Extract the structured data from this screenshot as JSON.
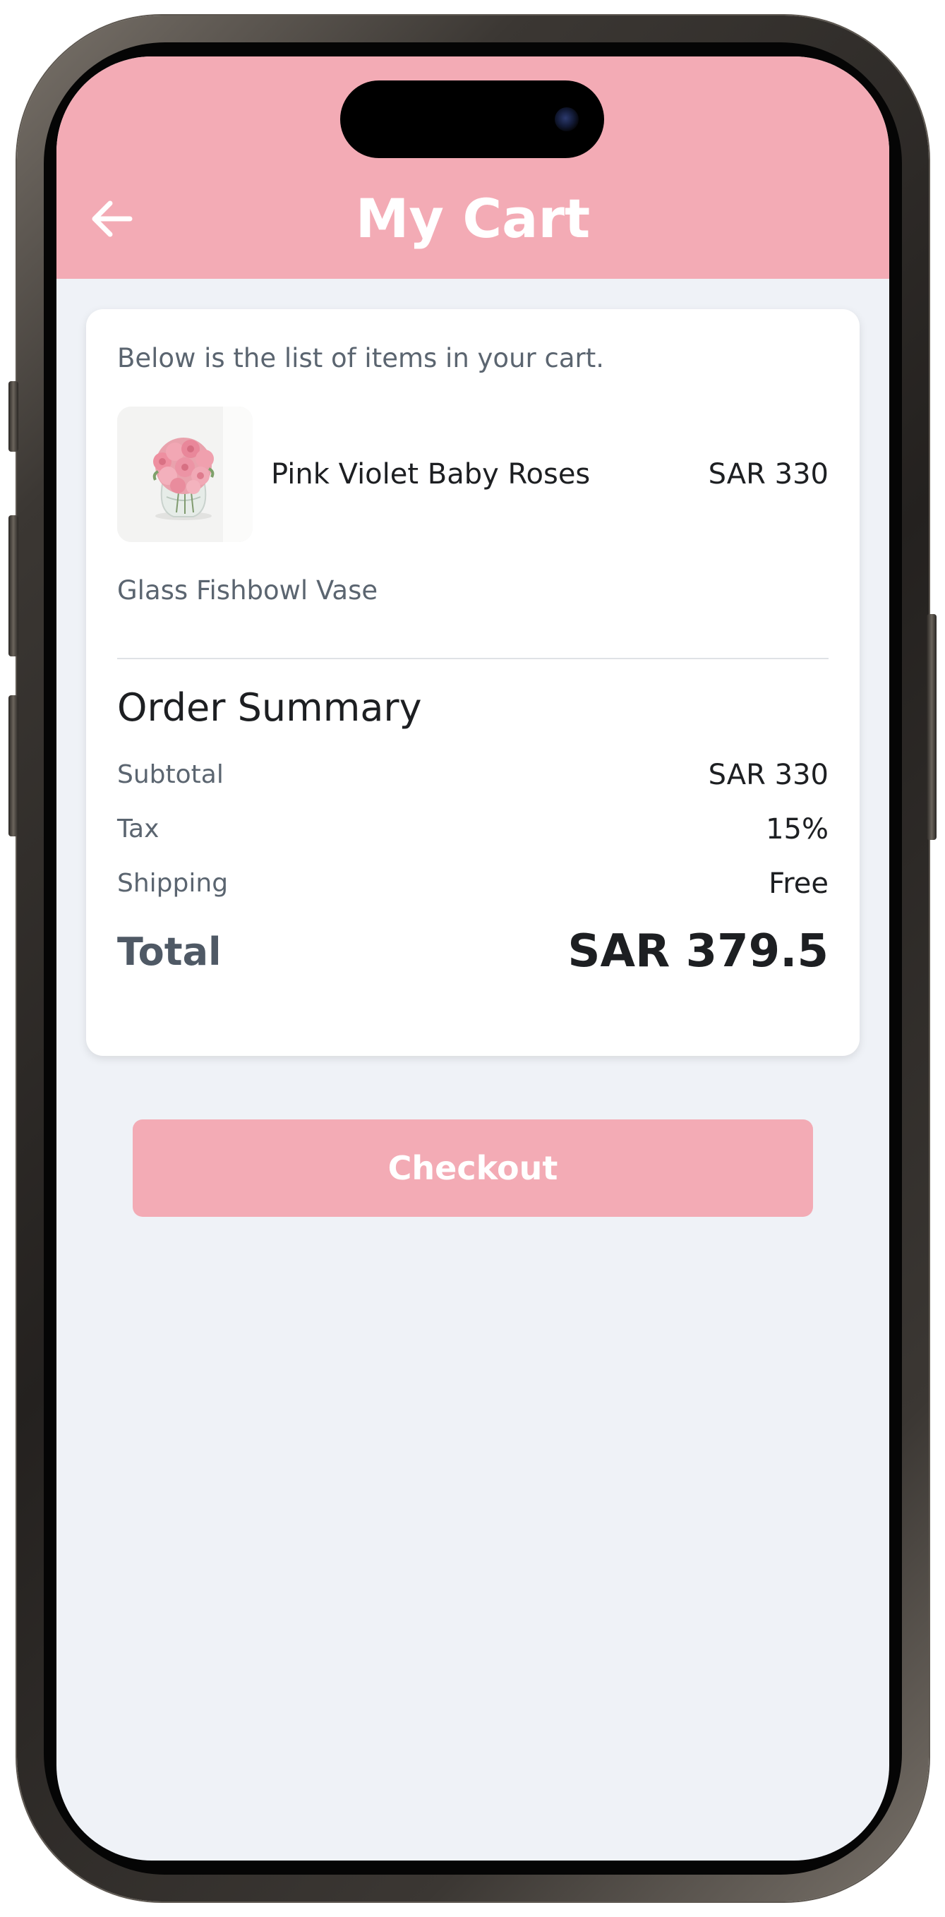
{
  "header": {
    "title": "My Cart",
    "back_icon": "arrow-left-icon",
    "background_color": "#f3abb5"
  },
  "cart": {
    "intro_text": "Below is the list of items in your cart.",
    "items": [
      {
        "name": "Pink Violet Baby Roses",
        "price": "SAR 330",
        "variant": "Glass Fishbowl Vase",
        "image": "pink-roses-bouquet-in-glass-vase"
      }
    ]
  },
  "summary": {
    "heading": "Order Summary",
    "subtotal_label": "Subtotal",
    "subtotal_value": "SAR 330",
    "tax_label": "Tax",
    "tax_value": "15%",
    "shipping_label": "Shipping",
    "shipping_value": "Free",
    "total_label": "Total",
    "total_value": "SAR 379.5"
  },
  "checkout": {
    "label": "Checkout",
    "background_color": "#f3abb5"
  }
}
